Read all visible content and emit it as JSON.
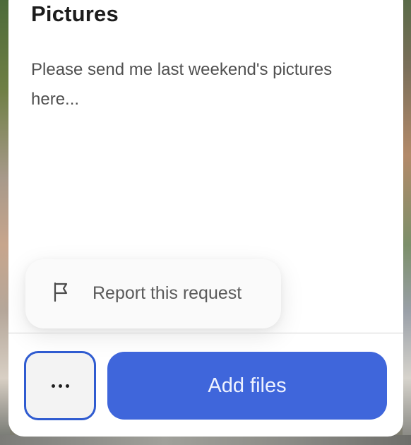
{
  "request": {
    "title": "Pictures",
    "message": "Please send me last weekend's pictures here..."
  },
  "menu": {
    "report_label": "Report this request",
    "report_icon": "flag-icon"
  },
  "actions": {
    "more_icon": "more-horizontal-icon",
    "add_files_label": "Add files"
  },
  "colors": {
    "primary": "#3f66db",
    "focus_ring": "#2f5bd0"
  }
}
